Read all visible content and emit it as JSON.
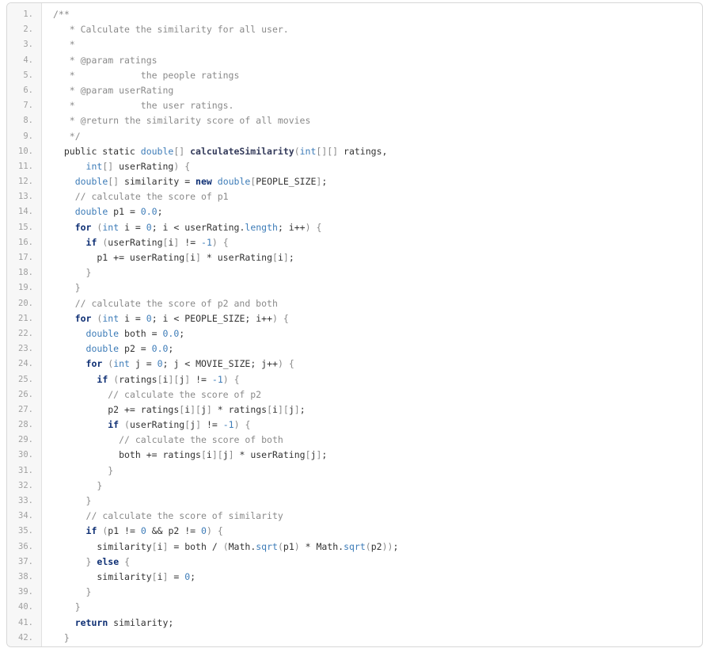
{
  "code_viewer": {
    "lines": [
      {
        "n": "1.",
        "html": "<span class=\"c\">/**</span>"
      },
      {
        "n": "2.",
        "html": "<span class=\"c\">   * Calculate the similarity for all user.</span>"
      },
      {
        "n": "3.",
        "html": "<span class=\"c\">   *</span>"
      },
      {
        "n": "4.",
        "html": "<span class=\"c\">   * @param ratings</span>"
      },
      {
        "n": "5.",
        "html": "<span class=\"c\">   *            the people ratings</span>"
      },
      {
        "n": "6.",
        "html": "<span class=\"c\">   * @param userRating</span>"
      },
      {
        "n": "7.",
        "html": "<span class=\"c\">   *            the user ratings.</span>"
      },
      {
        "n": "8.",
        "html": "<span class=\"c\">   * @return the similarity score of all movies</span>"
      },
      {
        "n": "9.",
        "html": "<span class=\"c\">   */</span>"
      },
      {
        "n": "10.",
        "html": "  public static <span class=\"t\">double</span><span class=\"p\">[]</span> <span class=\"f\">calculateSimilarity</span><span class=\"p\">(</span><span class=\"t\">int</span><span class=\"p\">[][]</span> ratings,"
      },
      {
        "n": "11.",
        "html": "      <span class=\"t\">int</span><span class=\"p\">[]</span> userRating<span class=\"p\">)</span> <span class=\"p\">{</span>"
      },
      {
        "n": "12.",
        "html": "    <span class=\"t\">double</span><span class=\"p\">[]</span> similarity = <span class=\"kw\">new</span> <span class=\"t\">double</span><span class=\"p\">[</span>PEOPLE_SIZE<span class=\"p\">]</span>;"
      },
      {
        "n": "13.",
        "html": "    <span class=\"c\">// calculate the score of p1</span>"
      },
      {
        "n": "14.",
        "html": "    <span class=\"t\">double</span> p1 = <span class=\"n\">0.0</span>;"
      },
      {
        "n": "15.",
        "html": "    <span class=\"kw\">for</span> <span class=\"p\">(</span><span class=\"t\">int</span> i = <span class=\"n\">0</span>; i &lt; userRating.<span class=\"m\">length</span>; i++<span class=\"p\">)</span> <span class=\"p\">{</span>"
      },
      {
        "n": "16.",
        "html": "      <span class=\"kw\">if</span> <span class=\"p\">(</span>userRating<span class=\"p\">[</span>i<span class=\"p\">]</span> != <span class=\"n\">-1</span><span class=\"p\">)</span> <span class=\"p\">{</span>"
      },
      {
        "n": "17.",
        "html": "        p1 += userRating<span class=\"p\">[</span>i<span class=\"p\">]</span> * userRating<span class=\"p\">[</span>i<span class=\"p\">]</span>;"
      },
      {
        "n": "18.",
        "html": "      <span class=\"p\">}</span>"
      },
      {
        "n": "19.",
        "html": "    <span class=\"p\">}</span>"
      },
      {
        "n": "20.",
        "html": "    <span class=\"c\">// calculate the score of p2 and both</span>"
      },
      {
        "n": "21.",
        "html": "    <span class=\"kw\">for</span> <span class=\"p\">(</span><span class=\"t\">int</span> i = <span class=\"n\">0</span>; i &lt; PEOPLE_SIZE; i++<span class=\"p\">)</span> <span class=\"p\">{</span>"
      },
      {
        "n": "22.",
        "html": "      <span class=\"t\">double</span> both = <span class=\"n\">0.0</span>;"
      },
      {
        "n": "23.",
        "html": "      <span class=\"t\">double</span> p2 = <span class=\"n\">0.0</span>;"
      },
      {
        "n": "24.",
        "html": "      <span class=\"kw\">for</span> <span class=\"p\">(</span><span class=\"t\">int</span> j = <span class=\"n\">0</span>; j &lt; MOVIE_SIZE; j++<span class=\"p\">)</span> <span class=\"p\">{</span>"
      },
      {
        "n": "25.",
        "html": "        <span class=\"kw\">if</span> <span class=\"p\">(</span>ratings<span class=\"p\">[</span>i<span class=\"p\">][</span>j<span class=\"p\">]</span> != <span class=\"n\">-1</span><span class=\"p\">)</span> <span class=\"p\">{</span>"
      },
      {
        "n": "26.",
        "html": "          <span class=\"c\">// calculate the score of p2</span>"
      },
      {
        "n": "27.",
        "html": "          p2 += ratings<span class=\"p\">[</span>i<span class=\"p\">][</span>j<span class=\"p\">]</span> * ratings<span class=\"p\">[</span>i<span class=\"p\">][</span>j<span class=\"p\">]</span>;"
      },
      {
        "n": "28.",
        "html": "          <span class=\"kw\">if</span> <span class=\"p\">(</span>userRating<span class=\"p\">[</span>j<span class=\"p\">]</span> != <span class=\"n\">-1</span><span class=\"p\">)</span> <span class=\"p\">{</span>"
      },
      {
        "n": "29.",
        "html": "            <span class=\"c\">// calculate the score of both</span>"
      },
      {
        "n": "30.",
        "html": "            both += ratings<span class=\"p\">[</span>i<span class=\"p\">][</span>j<span class=\"p\">]</span> * userRating<span class=\"p\">[</span>j<span class=\"p\">]</span>;"
      },
      {
        "n": "31.",
        "html": "          <span class=\"p\">}</span>"
      },
      {
        "n": "32.",
        "html": "        <span class=\"p\">}</span>"
      },
      {
        "n": "33.",
        "html": "      <span class=\"p\">}</span>"
      },
      {
        "n": "34.",
        "html": "      <span class=\"c\">// calculate the score of similarity</span>"
      },
      {
        "n": "35.",
        "html": "      <span class=\"kw\">if</span> <span class=\"p\">(</span>p1 != <span class=\"n\">0</span> &amp;&amp; p2 != <span class=\"n\">0</span><span class=\"p\">)</span> <span class=\"p\">{</span>"
      },
      {
        "n": "36.",
        "html": "        similarity<span class=\"p\">[</span>i<span class=\"p\">]</span> = both / <span class=\"p\">(</span>Math.<span class=\"m\">sqrt</span><span class=\"p\">(</span>p1<span class=\"p\">)</span> * Math.<span class=\"m\">sqrt</span><span class=\"p\">(</span>p2<span class=\"p\">))</span>;"
      },
      {
        "n": "37.",
        "html": "      <span class=\"p\">}</span> <span class=\"kw\">else</span> <span class=\"p\">{</span>"
      },
      {
        "n": "38.",
        "html": "        similarity<span class=\"p\">[</span>i<span class=\"p\">]</span> = <span class=\"n\">0</span>;"
      },
      {
        "n": "39.",
        "html": "      <span class=\"p\">}</span>"
      },
      {
        "n": "40.",
        "html": "    <span class=\"p\">}</span>"
      },
      {
        "n": "41.",
        "html": "    <span class=\"kw\">return</span> similarity;"
      },
      {
        "n": "42.",
        "html": "  <span class=\"p\">}</span>"
      }
    ]
  }
}
